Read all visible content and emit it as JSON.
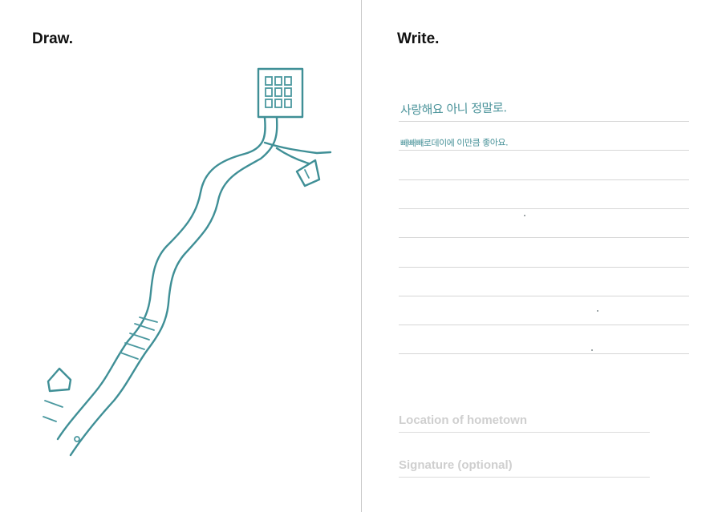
{
  "left_page": {
    "heading": "Draw."
  },
  "right_page": {
    "heading": "Write.",
    "handwriting": [
      "사랑해요 아니 정말로.",
      "빼빼빼로데이에 이만큼 좋아요."
    ],
    "fields": [
      {
        "label": "Location of hometown"
      },
      {
        "label": "Signature (optional)"
      }
    ]
  },
  "colors": {
    "ink": "#3f8f96",
    "rule_line": "#d6d6d6",
    "field_label": "#cfcfcf",
    "heading": "#111111"
  }
}
